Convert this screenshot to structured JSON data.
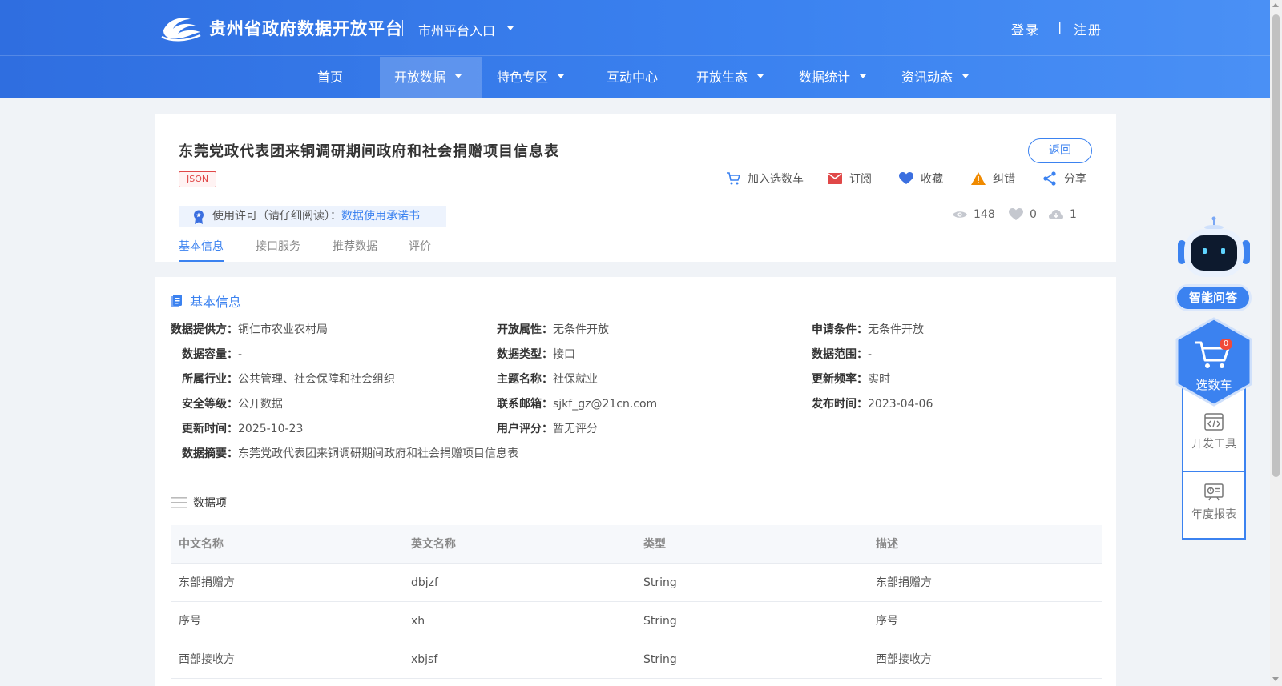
{
  "header": {
    "brand": "贵州省政府数据开放平台",
    "city_entry": "市州平台入口",
    "login": "登录",
    "auth_separator": "|",
    "register": "注册"
  },
  "nav": [
    {
      "label": "首页",
      "dropdown": false
    },
    {
      "label": "开放数据",
      "dropdown": true,
      "active": true
    },
    {
      "label": "特色专区",
      "dropdown": true
    },
    {
      "label": "互动中心",
      "dropdown": false
    },
    {
      "label": "开放生态",
      "dropdown": true
    },
    {
      "label": "数据统计",
      "dropdown": true
    },
    {
      "label": "资讯动态",
      "dropdown": true
    }
  ],
  "dataset": {
    "title": "东莞党政代表团来铜调研期间政府和社会捐赠项目信息表",
    "format_badge": "JSON",
    "back_label": "返回",
    "actions": {
      "cart": "加入选数车",
      "subscribe": "订阅",
      "favorite": "收藏",
      "report": "纠错",
      "share": "分享"
    },
    "license": {
      "label": "使用许可（请仔细阅读）：",
      "link": "数据使用承诺书"
    },
    "stats": {
      "views": "148",
      "likes": "0",
      "downloads": "1"
    },
    "tabs": [
      "基本信息",
      "接口服务",
      "推荐数据",
      "评价"
    ]
  },
  "basic_info": {
    "section_title": "基本信息",
    "fields": [
      {
        "label": "数据提供方：",
        "value": "铜仁市农业农村局"
      },
      {
        "label": "开放属性：",
        "value": "无条件开放"
      },
      {
        "label": "申请条件：",
        "value": "无条件开放"
      },
      {
        "label": "数据容量：",
        "value": "-"
      },
      {
        "label": "数据类型：",
        "value": "接口"
      },
      {
        "label": "数据范围：",
        "value": "-"
      },
      {
        "label": "所属行业：",
        "value": "公共管理、社会保障和社会组织"
      },
      {
        "label": "主题名称：",
        "value": "社保就业"
      },
      {
        "label": "更新频率：",
        "value": "实时"
      },
      {
        "label": "安全等级：",
        "value": "公开数据"
      },
      {
        "label": "联系邮箱：",
        "value": "sjkf_gz@21cn.com"
      },
      {
        "label": "发布时间：",
        "value": "2023-04-06"
      },
      {
        "label": "更新时间：",
        "value": "2025-10-23"
      },
      {
        "label": "用户评分：",
        "value": "暂无评分"
      },
      {
        "label": "数据摘要：",
        "value": "东莞党政代表团来铜调研期间政府和社会捐赠项目信息表"
      }
    ]
  },
  "data_items": {
    "section_title": "数据项",
    "columns": [
      "中文名称",
      "英文名称",
      "类型",
      "描述"
    ],
    "rows": [
      [
        "东部捐赠方",
        "dbjzf",
        "String",
        "东部捐赠方"
      ],
      [
        "序号",
        "xh",
        "String",
        "序号"
      ],
      [
        "西部接收方",
        "xbjsf",
        "String",
        "西部接收方"
      ]
    ]
  },
  "side_panel": {
    "ai_label": "智能问答",
    "cart_label": "选数车",
    "cart_count": "0",
    "dev_tools": "开发工具",
    "annual_report": "年度报表"
  },
  "colors": {
    "primary": "#3b82f0",
    "badge_red": "#e04848",
    "warning": "#f08a00"
  }
}
